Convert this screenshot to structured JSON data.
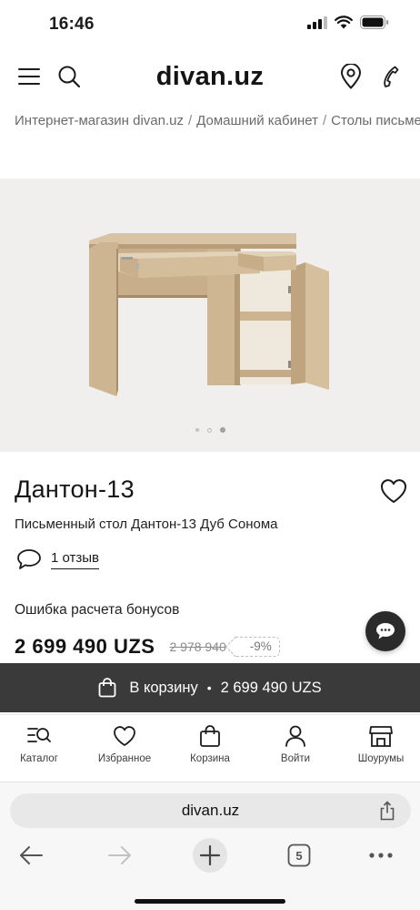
{
  "status": {
    "time": "16:46"
  },
  "header": {
    "logo": "divan.uz"
  },
  "breadcrumb": {
    "items": [
      "Интернет-магазин divan.uz",
      "Домашний кабинет",
      "Столы письменные"
    ],
    "separator": "/"
  },
  "gallery": {
    "image_count": 3,
    "active_index": 2,
    "image": "desk-sonoma-oak"
  },
  "product": {
    "title": "Дантон-13",
    "subtitle": "Письменный стол Дантон-13 Дуб Сонома",
    "reviews": "1 отзыв",
    "bonus_error": "Ошибка расчета бонусов",
    "price": "2 699 490 UZS",
    "old_price": "2 978 940",
    "discount": "-9%"
  },
  "cart_bar": {
    "label": "В корзину",
    "bullet": "•",
    "price": "2 699 490 UZS"
  },
  "tabbar": {
    "items": [
      {
        "label": "Каталог",
        "icon": "catalog-search-icon"
      },
      {
        "label": "Избранное",
        "icon": "heart-icon"
      },
      {
        "label": "Корзина",
        "icon": "shopping-bag-icon"
      },
      {
        "label": "Войти",
        "icon": "user-icon"
      },
      {
        "label": "Шоурумы",
        "icon": "store-icon"
      }
    ]
  },
  "browser": {
    "url": "divan.uz",
    "tabs_count": "5"
  },
  "colors": {
    "cart_bar": "#3a3a3a",
    "chat_button": "#2b2b2b",
    "gallery_bg": "#f0efee",
    "wood": "#d2bb98"
  }
}
